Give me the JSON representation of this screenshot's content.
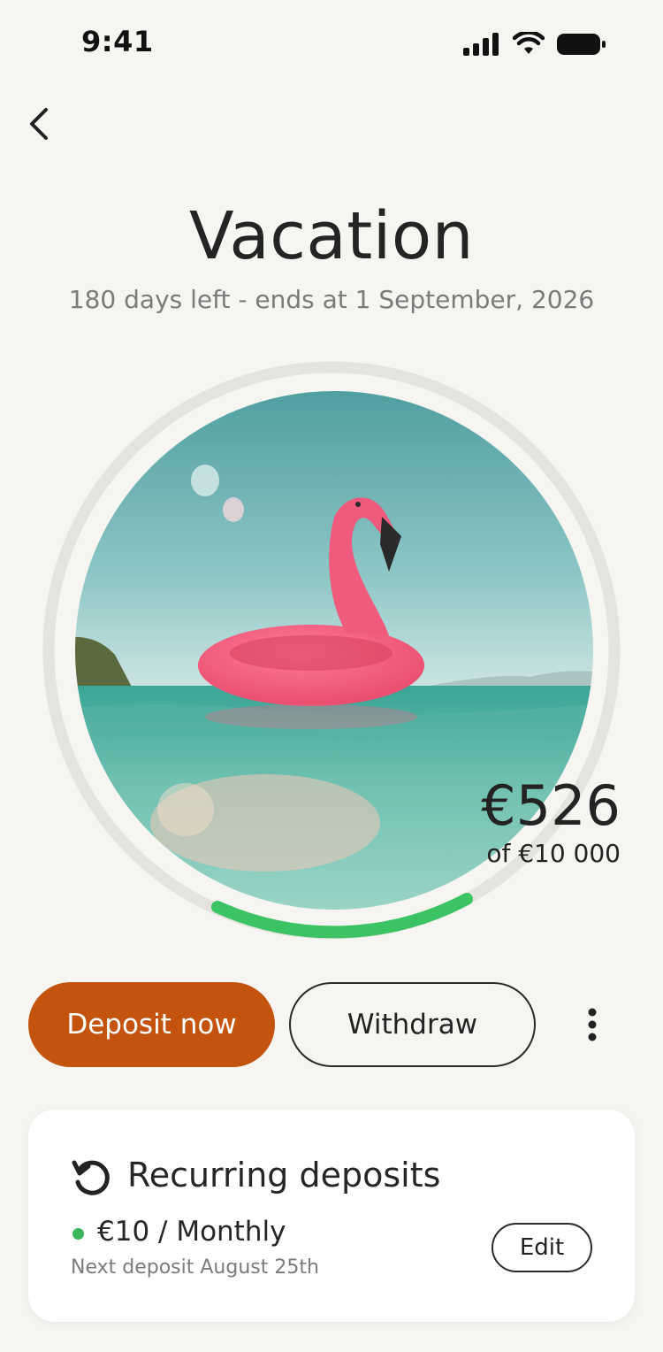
{
  "status_bar": {
    "time": "9:41"
  },
  "header": {
    "back_icon": "chevron-left-icon"
  },
  "goal": {
    "title": "Vacation",
    "subtitle": "180 days left - ends at 1 September, 2026",
    "image": "flamingo-float-photo",
    "saved": "€526",
    "target": "of €10 000",
    "progress_fraction": 0.0526,
    "progress_color": "#3cc363"
  },
  "actions": {
    "deposit_label": "Deposit now",
    "withdraw_label": "Withdraw",
    "more_icon": "more-vertical-icon",
    "accent": "#c4530e"
  },
  "recurring": {
    "title": "Recurring deposits",
    "icon": "recurring-icon",
    "amount": "€10 / Monthly",
    "next": "Next deposit August 25th",
    "edit_label": "Edit",
    "status_color": "#3bb65c"
  }
}
